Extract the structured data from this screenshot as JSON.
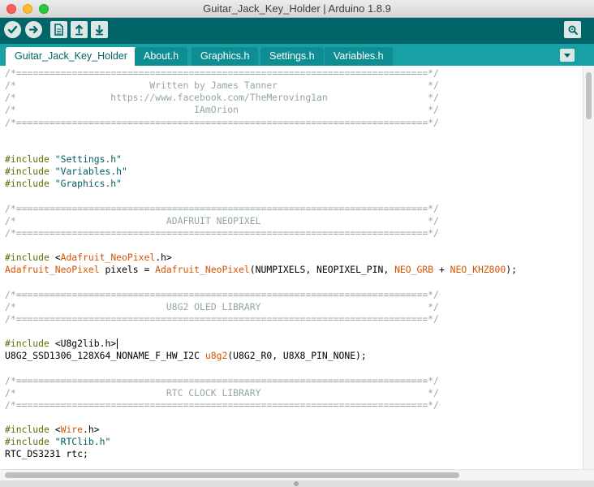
{
  "window": {
    "title": "Guitar_Jack_Key_Holder | Arduino 1.8.9"
  },
  "toolbar": {
    "verify": {
      "icon": "check-icon"
    },
    "upload": {
      "icon": "arrow-right-icon"
    },
    "new": {
      "icon": "new-file-icon"
    },
    "open": {
      "icon": "open-arrow-up-icon"
    },
    "save": {
      "icon": "save-arrow-down-icon"
    },
    "serial_monitor": {
      "icon": "magnifier-icon"
    }
  },
  "tabs": [
    {
      "label": "Guitar_Jack_Key_Holder",
      "active": true
    },
    {
      "label": "About.h",
      "active": false
    },
    {
      "label": "Graphics.h",
      "active": false
    },
    {
      "label": "Settings.h",
      "active": false
    },
    {
      "label": "Variables.h",
      "active": false
    }
  ],
  "colors": {
    "toolbar": "#006468",
    "tabbar": "#17a1a5",
    "tab_inactive": "#0e8e92",
    "comment": "#95a5a6",
    "preprocessor": "#5e6d03",
    "string": "#005c5f",
    "keyword_type": "#d35400"
  },
  "code": {
    "lines": [
      [
        [
          "cm",
          "/*==========================================================================*/"
        ]
      ],
      [
        [
          "cm",
          "/*                        Written by James Tanner                           */"
        ]
      ],
      [
        [
          "cm",
          "/*                 https://www.facebook.com/TheMeroving1an                  */"
        ]
      ],
      [
        [
          "cm",
          "/*                                IAmOrion                                  */"
        ]
      ],
      [
        [
          "cm",
          "/*==========================================================================*/"
        ]
      ],
      [],
      [],
      [
        [
          "pp",
          "#include "
        ],
        [
          "st",
          "\"Settings.h\""
        ]
      ],
      [
        [
          "pp",
          "#include "
        ],
        [
          "st",
          "\"Variables.h\""
        ]
      ],
      [
        [
          "pp",
          "#include "
        ],
        [
          "st",
          "\"Graphics.h\""
        ]
      ],
      [],
      [
        [
          "cm",
          "/*==========================================================================*/"
        ]
      ],
      [
        [
          "cm",
          "/*                           ADAFRUIT NEOPIXEL                              */"
        ]
      ],
      [
        [
          "cm",
          "/*==========================================================================*/"
        ]
      ],
      [],
      [
        [
          "pp",
          "#include "
        ],
        [
          "tx",
          "<"
        ],
        [
          "ty",
          "Adafruit_NeoPixel"
        ],
        [
          "tx",
          ".h>"
        ]
      ],
      [
        [
          "ty",
          "Adafruit_NeoPixel"
        ],
        [
          "tx",
          " pixels = "
        ],
        [
          "ty",
          "Adafruit_NeoPixel"
        ],
        [
          "tx",
          "(NUMPIXELS, NEOPIXEL_PIN, "
        ],
        [
          "ty",
          "NEO_GRB"
        ],
        [
          "tx",
          " + "
        ],
        [
          "ty",
          "NEO_KHZ800"
        ],
        [
          "tx",
          ");"
        ]
      ],
      [],
      [
        [
          "cm",
          "/*==========================================================================*/"
        ]
      ],
      [
        [
          "cm",
          "/*                           U8G2 OLED LIBRARY                              */"
        ]
      ],
      [
        [
          "cm",
          "/*==========================================================================*/"
        ]
      ],
      [],
      [
        [
          "pp",
          "#include "
        ],
        [
          "tx",
          "<U8g2lib.h>"
        ],
        [
          "caret",
          ""
        ]
      ],
      [
        [
          "tx",
          "U8G2_SSD1306_128X64_NONAME_F_HW_I2C "
        ],
        [
          "ty",
          "u8g2"
        ],
        [
          "tx",
          "(U8G2_R0, U8X8_PIN_NONE);"
        ]
      ],
      [],
      [
        [
          "cm",
          "/*==========================================================================*/"
        ]
      ],
      [
        [
          "cm",
          "/*                           RTC CLOCK LIBRARY                              */"
        ]
      ],
      [
        [
          "cm",
          "/*==========================================================================*/"
        ]
      ],
      [],
      [
        [
          "pp",
          "#include "
        ],
        [
          "tx",
          "<"
        ],
        [
          "ty",
          "Wire"
        ],
        [
          "tx",
          ".h>"
        ]
      ],
      [
        [
          "pp",
          "#include "
        ],
        [
          "st",
          "\"RTClib.h\""
        ]
      ],
      [
        [
          "tx",
          "RTC_DS3231 rtc;"
        ]
      ],
      [],
      [
        [
          "cm",
          "/*==========================================================================*/"
        ]
      ]
    ]
  }
}
